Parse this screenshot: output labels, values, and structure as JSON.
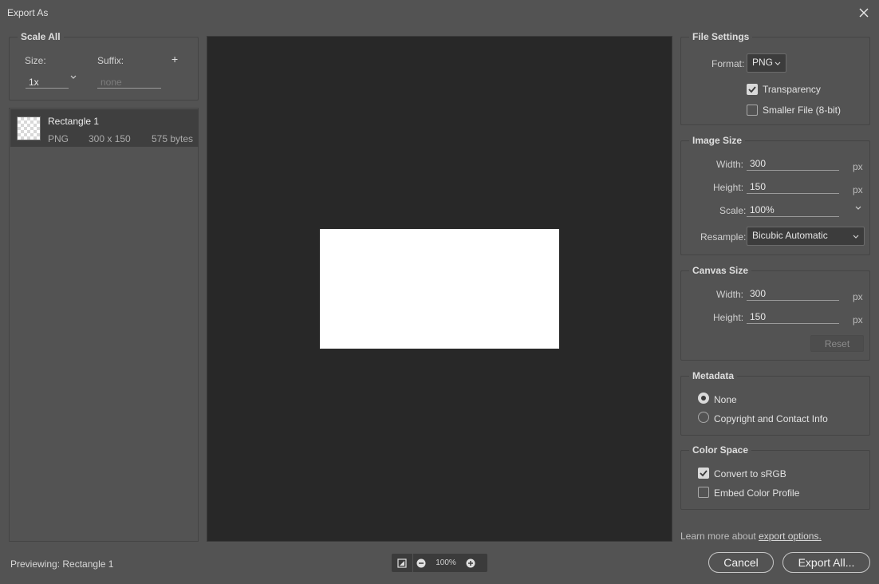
{
  "window": {
    "title": "Export As"
  },
  "scale_all": {
    "title": "Scale All",
    "size_label": "Size:",
    "size_value": "1x",
    "suffix_label": "Suffix:",
    "suffix_placeholder": "none",
    "add_symbol": "+"
  },
  "assets": [
    {
      "name": "Rectangle 1",
      "format": "PNG",
      "dimensions": "300 x 150",
      "filesize": "575 bytes"
    }
  ],
  "preview": {
    "previewing_label": "Previewing:",
    "previewing_name": "Rectangle 1",
    "zoom_level": "100%"
  },
  "file_settings": {
    "title": "File Settings",
    "format_label": "Format:",
    "format_value": "PNG",
    "transparency_label": "Transparency",
    "transparency_checked": true,
    "smaller_file_label": "Smaller File (8-bit)",
    "smaller_file_checked": false
  },
  "image_size": {
    "title": "Image Size",
    "width_label": "Width:",
    "width_value": "300",
    "height_label": "Height:",
    "height_value": "150",
    "scale_label": "Scale:",
    "scale_value": "100%",
    "resample_label": "Resample:",
    "resample_value": "Bicubic Automatic",
    "unit": "px"
  },
  "canvas_size": {
    "title": "Canvas Size",
    "width_label": "Width:",
    "width_value": "300",
    "height_label": "Height:",
    "height_value": "150",
    "unit": "px",
    "reset_label": "Reset"
  },
  "metadata": {
    "title": "Metadata",
    "options": [
      {
        "label": "None",
        "checked": true
      },
      {
        "label": "Copyright and Contact Info",
        "checked": false
      }
    ]
  },
  "color_space": {
    "title": "Color Space",
    "convert_label": "Convert to sRGB",
    "convert_checked": true,
    "embed_label": "Embed Color Profile",
    "embed_checked": false
  },
  "footer": {
    "learn_more_prefix": "Learn more about ",
    "learn_more_link": "export options.",
    "cancel_label": "Cancel",
    "export_label": "Export All..."
  },
  "colors": {
    "dialog_bg": "#535353",
    "preview_bg": "#282828",
    "selected_row_bg": "#3f3f3f"
  }
}
